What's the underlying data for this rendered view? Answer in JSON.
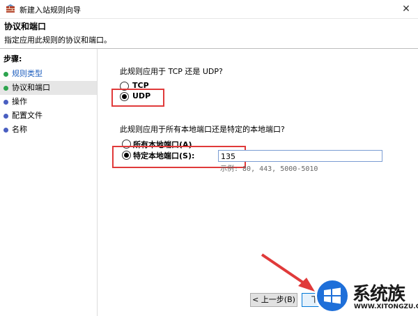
{
  "window": {
    "title": "新建入站规则向导",
    "close_glyph": "✕"
  },
  "header": {
    "title": "协议和端口",
    "subtitle": "指定应用此规则的协议和端口。"
  },
  "sidebar": {
    "steps_title": "步骤:",
    "items": [
      {
        "label": "规则类型",
        "dot_color": "#2da44e"
      },
      {
        "label": "协议和端口",
        "dot_color": "#2da44e",
        "active": true
      },
      {
        "label": "操作",
        "dot_color": "#4a5fc1"
      },
      {
        "label": "配置文件",
        "dot_color": "#4a5fc1"
      },
      {
        "label": "名称",
        "dot_color": "#4a5fc1"
      }
    ]
  },
  "protocol": {
    "question": "此规则应用于 TCP 还是 UDP?",
    "options": [
      {
        "label": "TCP",
        "selected": false
      },
      {
        "label": "UDP",
        "selected": true
      }
    ]
  },
  "ports": {
    "question": "此规则应用于所有本地端口还是特定的本地端口?",
    "options": [
      {
        "label": "所有本地端口(A)",
        "selected": false
      },
      {
        "label": "特定本地端口(S):",
        "selected": true
      }
    ],
    "value": "135",
    "example": "示例: 80, 443, 5000-5010"
  },
  "buttons": {
    "prev": "< 上一步(B)",
    "next": "下一步"
  },
  "watermark": {
    "text": "系统族",
    "url": "WWW.XITONGZU.COM"
  },
  "colors": {
    "highlight_red": "#e03a3a",
    "accent_blue": "#1e6fd9"
  }
}
